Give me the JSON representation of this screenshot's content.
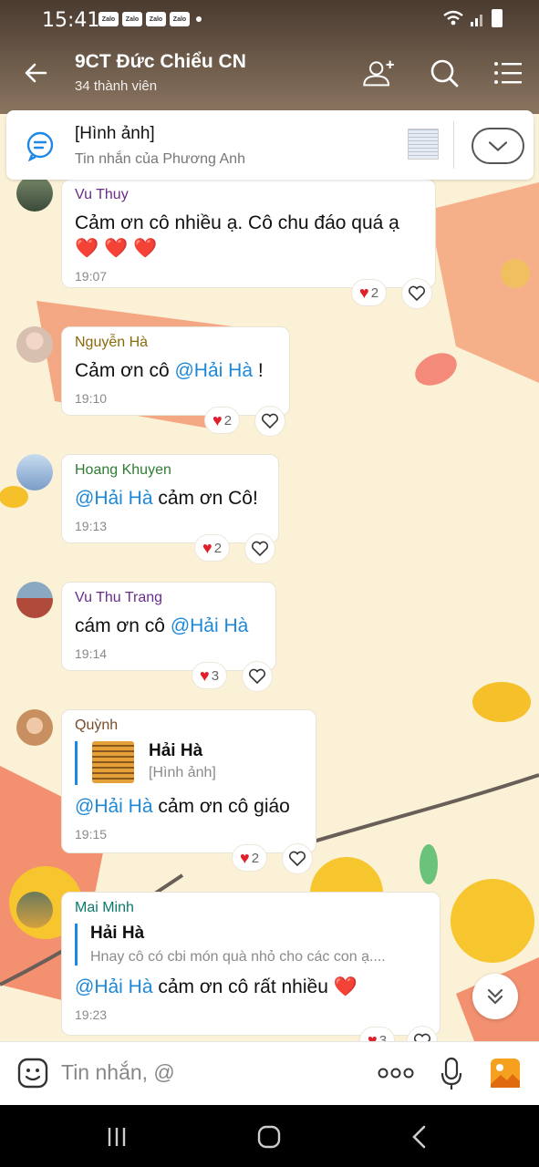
{
  "status": {
    "time": "15:41",
    "badges": [
      "Zalo",
      "Zalo",
      "Zalo",
      "Zalo"
    ]
  },
  "header": {
    "title": "9CT Đức Chiểu CN",
    "subtitle": "34 thành viên"
  },
  "pinned": {
    "title": "[Hình ảnh]",
    "subtitle": "Tin nhắn của Phương Anh"
  },
  "colors": {
    "mention": "#1e88d8",
    "header_bg": "#5a4a3c",
    "heart": "#e0202a"
  },
  "messages": [
    {
      "sender": "Vu Thuy",
      "sender_color": "#6a2d8c",
      "text_parts": [
        {
          "t": "Cảm ơn cô nhiều ạ. Cô chu đáo quá ạ",
          "m": false
        }
      ],
      "text_line2": "❤️ ❤️ ❤️",
      "time": "19:07",
      "reactions": "2"
    },
    {
      "sender": "Nguyễn Hà",
      "sender_color": "#8a6a0a",
      "text_parts": [
        {
          "t": "Cảm ơn cô ",
          "m": false
        },
        {
          "t": "@Hải Hà",
          "m": true
        },
        {
          "t": " !",
          "m": false
        }
      ],
      "time": "19:10",
      "reactions": "2"
    },
    {
      "sender": "Hoang Khuyen",
      "sender_color": "#2e7d32",
      "text_parts": [
        {
          "t": "@Hải Hà",
          "m": true
        },
        {
          "t": " cảm ơn Cô!",
          "m": false
        }
      ],
      "time": "19:13",
      "reactions": "2"
    },
    {
      "sender": "Vu Thu Trang",
      "sender_color": "#6a2d8c",
      "text_parts": [
        {
          "t": "cám ơn cô ",
          "m": false
        },
        {
          "t": "@Hải Hà",
          "m": true
        }
      ],
      "time": "19:14",
      "reactions": "3"
    },
    {
      "sender": "Quỳnh",
      "sender_color": "#7a4a2a",
      "quote_name": "Hải Hà",
      "quote_text": "[Hình ảnh]",
      "text_parts": [
        {
          "t": "@Hải Hà",
          "m": true
        },
        {
          "t": " cảm ơn cô giáo",
          "m": false
        }
      ],
      "time": "19:15",
      "reactions": "2"
    },
    {
      "sender": "Mai Minh",
      "sender_color": "#0a7a6a",
      "quote_name": "Hải Hà",
      "quote_text": "Hnay cô có cbi món quà nhỏ cho các con ạ....",
      "text_parts": [
        {
          "t": "@Hải Hà",
          "m": true
        },
        {
          "t": " cảm ơn cô rất nhiều ",
          "m": false
        },
        {
          "t": "❤️",
          "m": false
        }
      ],
      "time": "19:23",
      "reactions": "3"
    }
  ],
  "input": {
    "placeholder": "Tin nhắn, @"
  }
}
